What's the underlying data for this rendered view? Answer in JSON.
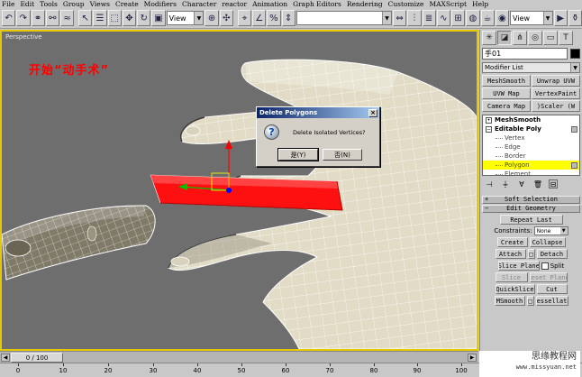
{
  "menu": [
    "File",
    "Edit",
    "Tools",
    "Group",
    "Views",
    "Create",
    "Modifiers",
    "Character",
    "reactor",
    "Animation",
    "Graph Editors",
    "Rendering",
    "Customize",
    "MAXScript",
    "Help"
  ],
  "toolbar": {
    "view_dropdown_1": "View",
    "view_dropdown_2": "View"
  },
  "viewport": {
    "label": "Perspective",
    "overlay_title": "开始“动手术”"
  },
  "dialog": {
    "title": "Delete Polygons",
    "message": "Delete Isolated Vertices?",
    "yes_label": "是(Y)",
    "no_label": "否(N)",
    "close_glyph": "×"
  },
  "panel": {
    "object_name": "手01",
    "modifier_list": "Modifier List",
    "modifier_buttons": [
      "MeshSmooth",
      "Unwrap UVW",
      "UVW Map",
      "VertexPaint",
      "Camera Map",
      ")Scaler (W"
    ],
    "stack": {
      "meshsmooth": "MeshSmooth",
      "editable_poly": "Editable Poly",
      "sub_items": [
        "Vertex",
        "Edge",
        "Border",
        "Polygon",
        "Element"
      ],
      "selected": "Polygon"
    },
    "rollouts": {
      "soft_selection": "Soft Selection",
      "edit_geometry": "Edit Geometry"
    },
    "edit_geometry": {
      "repeat_last": "Repeat Last",
      "constraints_label": "Constraints:",
      "constraints_value": "None",
      "create": "Create",
      "collapse": "Collapse",
      "attach": "Attach",
      "detach": "Detach",
      "slice_plane": "Slice Plane",
      "split": "Split",
      "slice": "Slice",
      "reset_plane": "Reset Plane",
      "quickslice": "QuickSlice",
      "cut": "Cut",
      "msmooth": "MSmooth",
      "tessellate": "Tessellate"
    }
  },
  "timeslider": {
    "frame_label": "0 / 100",
    "ticks": [
      "0",
      "10",
      "20",
      "30",
      "40",
      "50",
      "60",
      "70",
      "80",
      "90",
      "100"
    ]
  },
  "watermark": {
    "title": "思缘教程网",
    "url": "www.missyuan.net"
  },
  "colors": {
    "viewport_bg": "#6e6e6e",
    "active_border": "#e6c800",
    "selected_polygons": "#ff1010",
    "overlay_text": "#ff0000",
    "stack_selection": "#ffff00"
  }
}
